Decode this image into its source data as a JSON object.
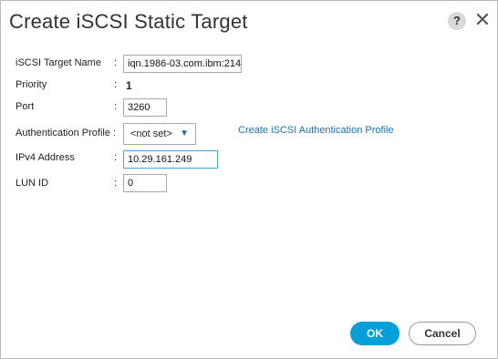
{
  "dialog": {
    "title": "Create iSCSI Static Target",
    "help_label": "?",
    "close_label": "✕"
  },
  "form": {
    "target_name": {
      "label": "iSCSI Target Name",
      "value": "iqn.1986-03.com.ibm:214"
    },
    "priority": {
      "label": "Priority",
      "value": "1"
    },
    "port": {
      "label": "Port",
      "value": "3260"
    },
    "auth_profile": {
      "label": "Authentication Profile :",
      "selected": "<not set>",
      "caret": "▼"
    },
    "create_link": "Create iSCSI Authentication Profile",
    "ipv4": {
      "label": "IPv4 Address",
      "value": "10.29.161.249"
    },
    "lun": {
      "label": "LUN ID",
      "value": "0"
    },
    "colon": ":"
  },
  "buttons": {
    "ok": "OK",
    "cancel": "Cancel"
  },
  "colors": {
    "ok_button": "#049fd9",
    "link": "#1b72b0",
    "focus_border": "#3fa8d8"
  }
}
